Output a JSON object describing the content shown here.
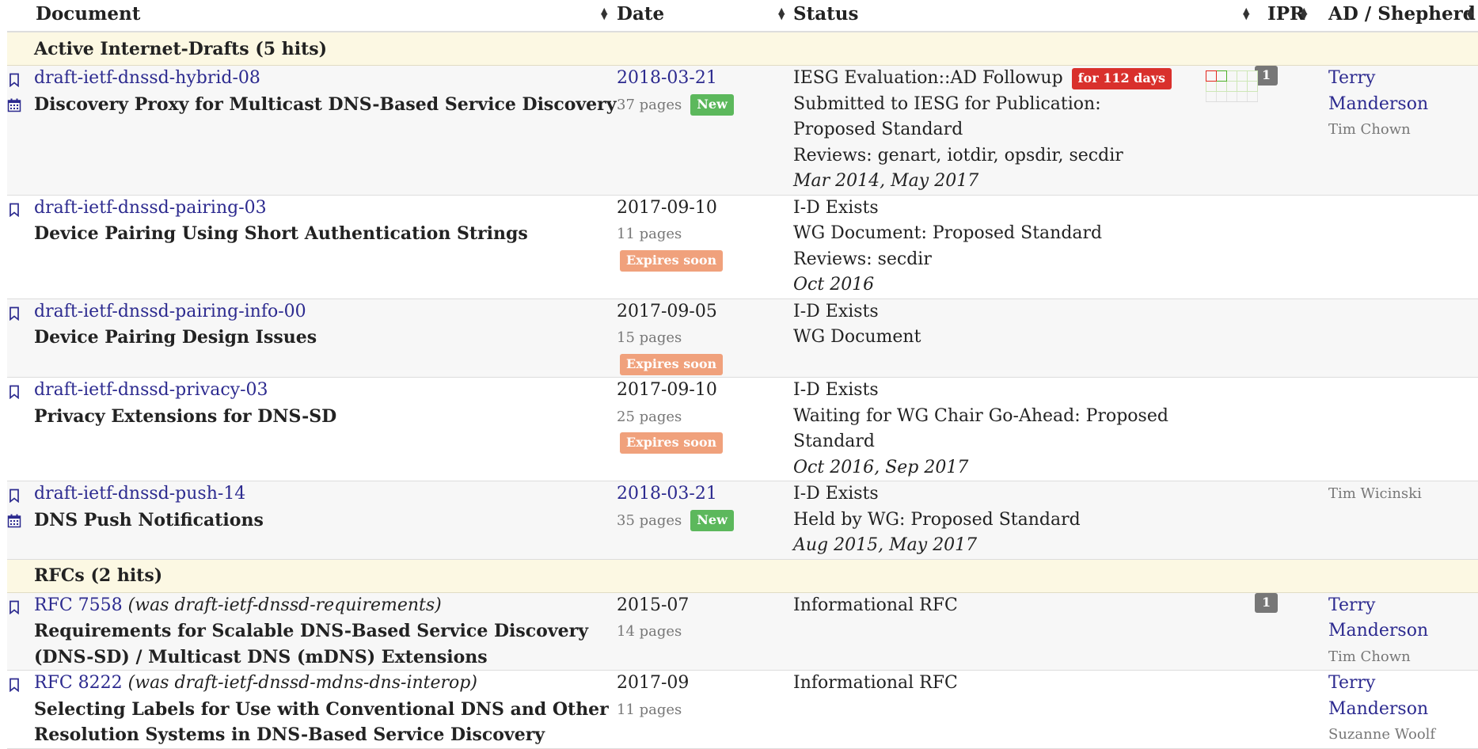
{
  "header": {
    "document": "Document",
    "date": "Date",
    "status": "Status",
    "ipr": "IPR",
    "ad": "AD / Shepherd"
  },
  "groups": {
    "drafts": "Active Internet-Drafts (5 hits)",
    "rfcs": "RFCs (2 hits)"
  },
  "rows": [
    {
      "name": "draft-ietf-dnssd-hybrid-08",
      "title": "Discovery Proxy for Multicast DNS-Based Service Discovery",
      "date": "2018-03-21",
      "pages": "37 pages",
      "badge": "New",
      "status": "IESG Evaluation::AD Followup",
      "status_badge": "for 112 days",
      "status2": "Submitted to IESG for Publication: Proposed Standard",
      "reviews": "Reviews: genart, iotdir, opsdir, secdir",
      "history": [
        "Mar 2014",
        "May 2017"
      ],
      "ipr": "1",
      "ad": "Terry Manderson",
      "shepherd": "Tim Chown"
    },
    {
      "name": "draft-ietf-dnssd-pairing-03",
      "title": "Device Pairing Using Short Authentication Strings",
      "date": "2017-09-10",
      "pages": "11 pages",
      "badge": "Expires soon",
      "status": "I-D Exists",
      "status2": "WG Document: Proposed Standard",
      "reviews": "Reviews: secdir",
      "history": [
        "Oct 2016"
      ]
    },
    {
      "name": "draft-ietf-dnssd-pairing-info-00",
      "title": "Device Pairing Design Issues",
      "date": "2017-09-05",
      "pages": "15 pages",
      "badge": "Expires soon",
      "status": "I-D Exists",
      "status2": "WG Document"
    },
    {
      "name": "draft-ietf-dnssd-privacy-03",
      "title": "Privacy Extensions for DNS-SD",
      "date": "2017-09-10",
      "pages": "25 pages",
      "badge": "Expires soon",
      "status": "I-D Exists",
      "status2": "Waiting for WG Chair Go-Ahead: Proposed Standard",
      "history": [
        "Oct 2016",
        "Sep 2017"
      ]
    },
    {
      "name": "draft-ietf-dnssd-push-14",
      "title": "DNS Push Notifications",
      "date": "2018-03-21",
      "pages": "35 pages",
      "badge": "New",
      "status": "I-D Exists",
      "status2": "Held by WG: Proposed Standard",
      "history": [
        "Aug 2015",
        "May 2017"
      ],
      "shepherd": "Tim Wicinski"
    },
    {
      "name": "RFC 7558",
      "was": "(was draft-ietf-dnssd-requirements)",
      "title": "Requirements for Scalable DNS-Based Service Discovery (DNS-SD) / Multicast DNS (mDNS) Extensions",
      "date": "2015-07",
      "pages": "14 pages",
      "status": "Informational RFC",
      "ipr": "1",
      "ad": "Terry Manderson",
      "shepherd": "Tim Chown"
    },
    {
      "name": "RFC 8222",
      "was": "(was draft-ietf-dnssd-mdns-dns-interop)",
      "title": "Selecting Labels for Use with Conventional DNS and Other Resolution Systems in DNS-Based Service Discovery",
      "date": "2017-09",
      "pages": "11 pages",
      "status": "Informational RFC",
      "ad": "Terry Manderson",
      "shepherd": "Suzanne Woolf"
    }
  ],
  "icons": {
    "bookmark": "bookmark-icon",
    "calendar": "calendar-icon",
    "sort": "sort-icon"
  },
  "colors": {
    "link": "#2c2a8f",
    "group_bg": "#fcf8e3",
    "badge_new": "#5cb85c",
    "badge_expires": "#f0a17c",
    "badge_days": "#d9302c"
  }
}
